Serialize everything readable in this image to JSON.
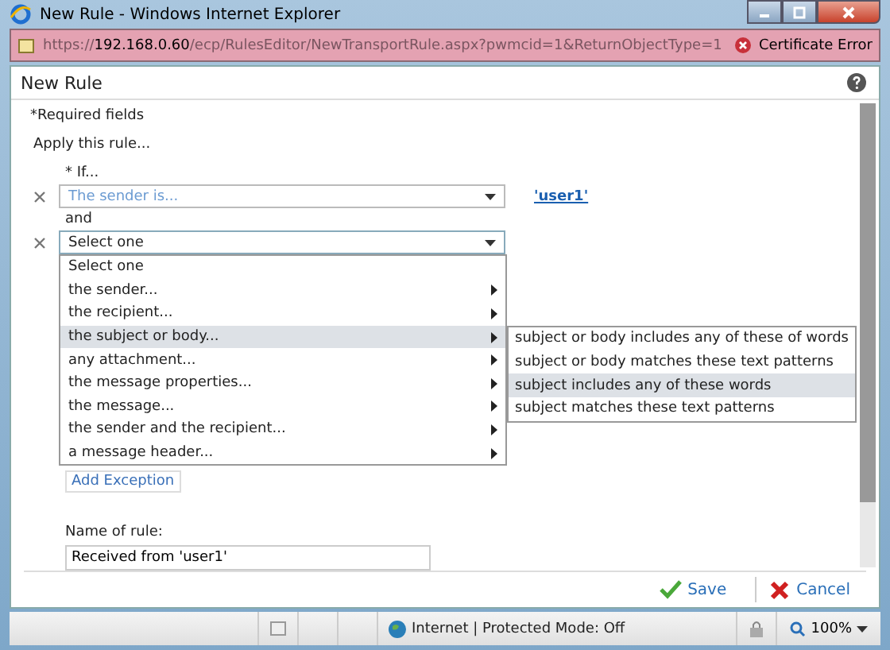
{
  "window": {
    "title": "New Rule - Windows Internet Explorer"
  },
  "address_bar": {
    "url_host_prefix": "https://",
    "url_host": "192.168.0.60",
    "url_path": "/ecp/RulesEditor/NewTransportRule.aspx?pwmcid=1&ReturnObjectType=1",
    "certificate_error": "Certificate Error"
  },
  "dialog": {
    "title": "New Rule",
    "required_note": "*Required fields",
    "apply_label": "Apply this rule...",
    "if_label": "* If...",
    "conditions": [
      {
        "value": "The sender is...",
        "kind": "filled",
        "link": "'user1'"
      },
      {
        "value": "Select one",
        "kind": "open"
      }
    ],
    "and_label": "and",
    "menu": [
      {
        "label": "Select one",
        "submenu": false,
        "selected": false
      },
      {
        "label": "the sender...",
        "submenu": true,
        "selected": false
      },
      {
        "label": "the recipient...",
        "submenu": true,
        "selected": false
      },
      {
        "label": "the subject or body...",
        "submenu": true,
        "selected": true
      },
      {
        "label": "any attachment...",
        "submenu": true,
        "selected": false
      },
      {
        "label": "the message properties...",
        "submenu": true,
        "selected": false
      },
      {
        "label": "the message...",
        "submenu": true,
        "selected": false
      },
      {
        "label": "the sender and the recipient...",
        "submenu": true,
        "selected": false
      },
      {
        "label": "a message header...",
        "submenu": true,
        "selected": false
      }
    ],
    "submenu": [
      {
        "label": "subject or body includes any of these of words",
        "selected": false
      },
      {
        "label": "subject or body matches these text patterns",
        "selected": false
      },
      {
        "label": "subject includes any of these words",
        "selected": true
      },
      {
        "label": "subject matches these text patterns",
        "selected": false
      }
    ],
    "add_exception": "Add Exception",
    "name_label": "Name of rule:",
    "name_value": "Received from 'user1'",
    "buttons": [
      {
        "label": "Save",
        "kind": "save"
      },
      {
        "label": "Cancel",
        "kind": "cancel"
      }
    ]
  },
  "status_bar": {
    "zone": "Internet | Protected Mode: Off",
    "zoom": "100%"
  }
}
